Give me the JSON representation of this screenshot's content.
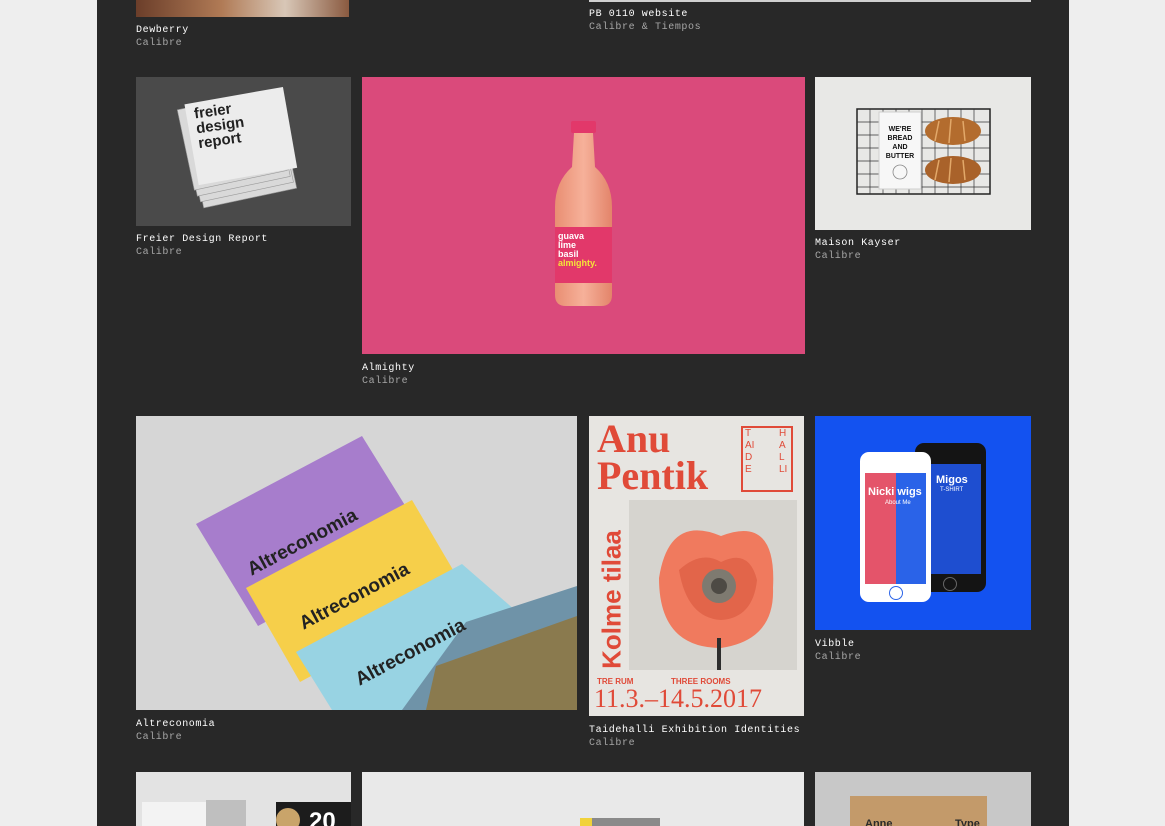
{
  "projects": [
    {
      "title": "Dewberry",
      "font": "Calibre"
    },
    {
      "title": "PB 0110 website",
      "font": "Calibre & Tiempos"
    },
    {
      "title": "Freier Design Report",
      "font": "Calibre"
    },
    {
      "title": "Almighty",
      "font": "Calibre"
    },
    {
      "title": "Maison Kayser",
      "font": "Calibre"
    },
    {
      "title": "Altreconomia",
      "font": "Calibre"
    },
    {
      "title": "Taidehalli Exhibition Identities",
      "font": "Calibre"
    },
    {
      "title": "Vibble",
      "font": "Calibre"
    }
  ],
  "artwork": {
    "freier": [
      "freier",
      "design",
      "report"
    ],
    "almighty": [
      "guava",
      "lime",
      "basil",
      "almighty."
    ],
    "kayser": [
      "WE'RE",
      "BREAD",
      "AND",
      "BUTTER"
    ],
    "altreconomia": "Altreconomia",
    "taidehalli": {
      "name1": "Anu",
      "name2": "Pentik",
      "side": "Kolme tilaa",
      "taide": "TAIDE",
      "halli": "HALLI",
      "rum": "TRE RUM",
      "rooms": "THREE ROOMS",
      "dates": "11.3.–14.5.2017"
    },
    "vibble": {
      "artist1": "Nicki wigs",
      "sub1": "About Me",
      "artist2": "Migos",
      "sub2": "T-SHIRT"
    },
    "bottom_left": "20",
    "bottom_right": [
      "Anne",
      "Type"
    ]
  },
  "colors": {
    "panel": "#282828",
    "page": "#eeeeee",
    "almighty": "#da4a7b",
    "vibble": "#1352f0",
    "taidehalli": "#e04a38"
  }
}
